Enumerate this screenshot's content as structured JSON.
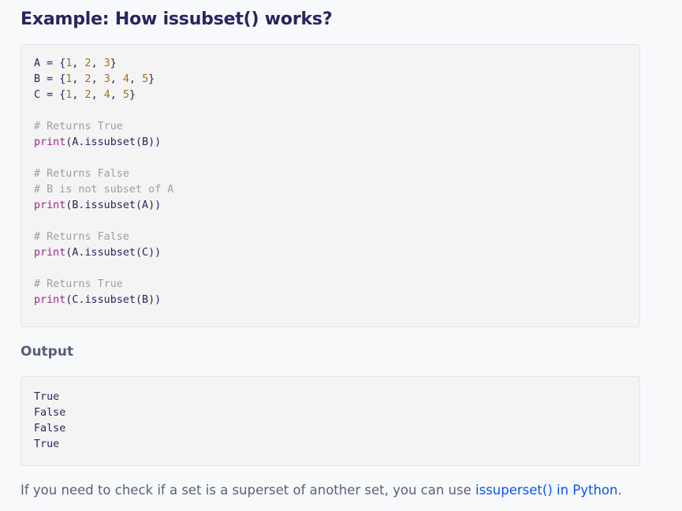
{
  "heading": "Example: How issubset() works?",
  "code": {
    "lines": [
      {
        "tokens": [
          {
            "t": "A = {",
            "c": "plain"
          },
          {
            "t": "1",
            "c": "num"
          },
          {
            "t": ", ",
            "c": "plain"
          },
          {
            "t": "2",
            "c": "num"
          },
          {
            "t": ", ",
            "c": "plain"
          },
          {
            "t": "3",
            "c": "num"
          },
          {
            "t": "}",
            "c": "plain"
          }
        ]
      },
      {
        "tokens": [
          {
            "t": "B = {",
            "c": "plain"
          },
          {
            "t": "1",
            "c": "num"
          },
          {
            "t": ", ",
            "c": "plain"
          },
          {
            "t": "2",
            "c": "num"
          },
          {
            "t": ", ",
            "c": "plain"
          },
          {
            "t": "3",
            "c": "num"
          },
          {
            "t": ", ",
            "c": "plain"
          },
          {
            "t": "4",
            "c": "num"
          },
          {
            "t": ", ",
            "c": "plain"
          },
          {
            "t": "5",
            "c": "num"
          },
          {
            "t": "}",
            "c": "plain"
          }
        ]
      },
      {
        "tokens": [
          {
            "t": "C = {",
            "c": "plain"
          },
          {
            "t": "1",
            "c": "num"
          },
          {
            "t": ", ",
            "c": "plain"
          },
          {
            "t": "2",
            "c": "num"
          },
          {
            "t": ", ",
            "c": "plain"
          },
          {
            "t": "4",
            "c": "num"
          },
          {
            "t": ", ",
            "c": "plain"
          },
          {
            "t": "5",
            "c": "num"
          },
          {
            "t": "}",
            "c": "plain"
          }
        ]
      },
      {
        "tokens": []
      },
      {
        "tokens": [
          {
            "t": "# Returns True",
            "c": "comment"
          }
        ]
      },
      {
        "tokens": [
          {
            "t": "print",
            "c": "fn"
          },
          {
            "t": "(A.issubset(B))",
            "c": "plain"
          }
        ]
      },
      {
        "tokens": []
      },
      {
        "tokens": [
          {
            "t": "# Returns False",
            "c": "comment"
          }
        ]
      },
      {
        "tokens": [
          {
            "t": "# B is not subset of A",
            "c": "comment"
          }
        ]
      },
      {
        "tokens": [
          {
            "t": "print",
            "c": "fn"
          },
          {
            "t": "(B.issubset(A))",
            "c": "plain"
          }
        ]
      },
      {
        "tokens": []
      },
      {
        "tokens": [
          {
            "t": "# Returns False",
            "c": "comment"
          }
        ]
      },
      {
        "tokens": [
          {
            "t": "print",
            "c": "fn"
          },
          {
            "t": "(A.issubset(C))",
            "c": "plain"
          }
        ]
      },
      {
        "tokens": []
      },
      {
        "tokens": [
          {
            "t": "# Returns True",
            "c": "comment"
          }
        ]
      },
      {
        "tokens": [
          {
            "t": "print",
            "c": "fn"
          },
          {
            "t": "(C.issubset(B))",
            "c": "plain"
          }
        ]
      }
    ]
  },
  "output": {
    "label": "Output",
    "lines": [
      "True",
      "False",
      "False",
      "True"
    ]
  },
  "footer": {
    "text": "If you need to check if a set is a superset of another set, you can use ",
    "link_text": "issuperset() in Python",
    "suffix": "."
  },
  "colors": {
    "heading": "#25265e",
    "number": "#a0721c",
    "comment": "#9aa0a6",
    "function": "#a0268f",
    "link": "#0556f3"
  }
}
